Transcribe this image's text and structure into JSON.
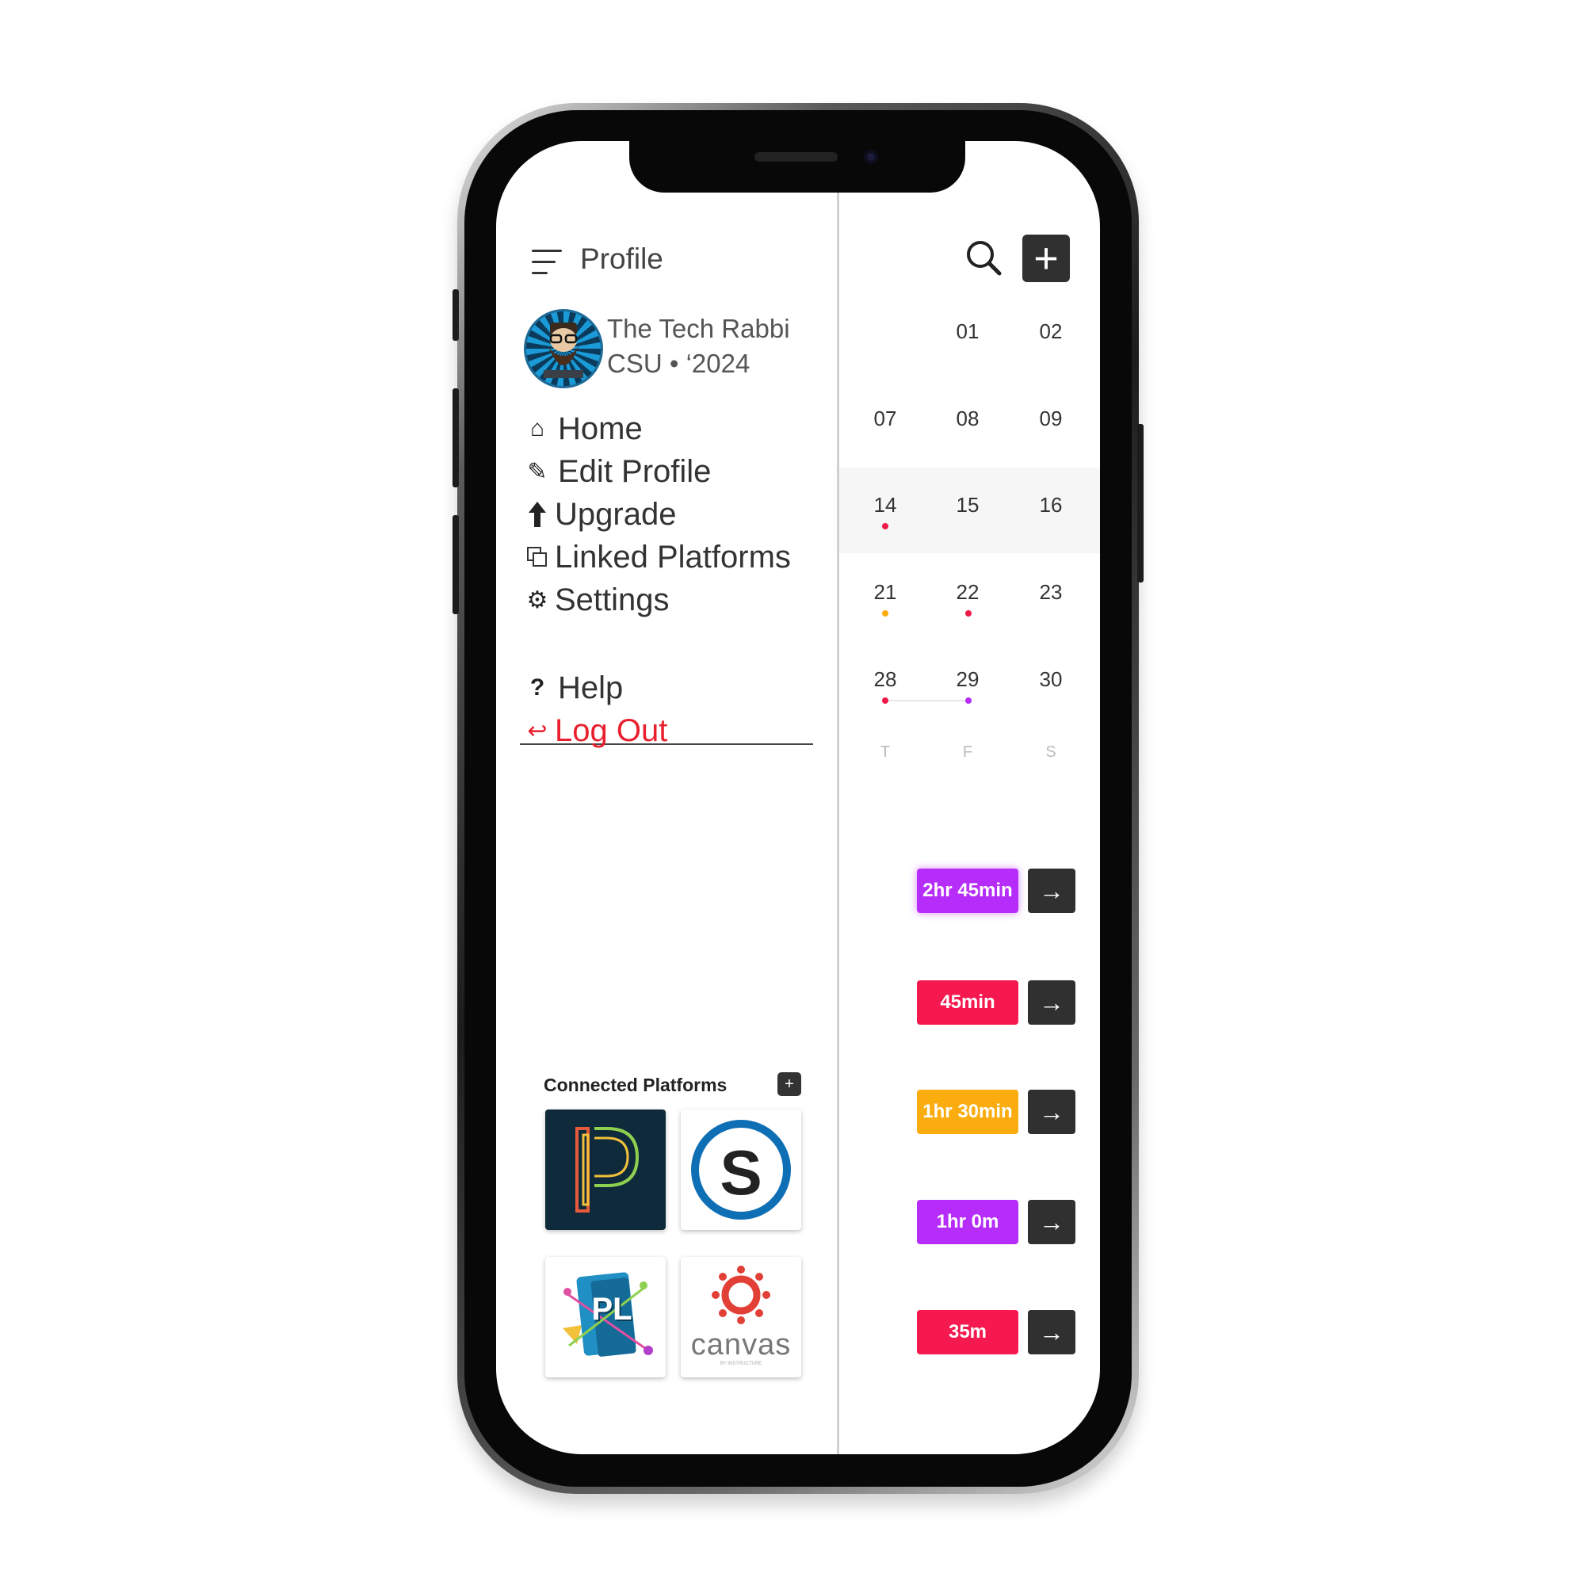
{
  "drawer": {
    "title": "Profile",
    "user_name": "The Tech Rabbi",
    "user_sub": "CSU • ‘2024",
    "nav": [
      {
        "label": "Home",
        "icon": "home-icon"
      },
      {
        "label": "Edit Profile",
        "icon": "pencil-icon"
      },
      {
        "label": "Upgrade",
        "icon": "up-arrow-icon"
      },
      {
        "label": "Linked Platforms",
        "icon": "linked-windows-icon"
      },
      {
        "label": "Settings",
        "icon": "gear-icon"
      }
    ],
    "help": {
      "label": "Help",
      "icon": "question-icon"
    },
    "logout": {
      "label": "Log Out",
      "icon": "return-arrow-icon"
    },
    "connected_platforms": {
      "label": "Connected Platforms",
      "add_label": "+",
      "tiles": [
        {
          "name": "PowerSchool",
          "icon": "powerschool-logo"
        },
        {
          "name": "Schoology",
          "icon": "schoology-logo",
          "letter": "S"
        },
        {
          "name": "PL",
          "icon": "pl-logo",
          "letter": "PL"
        },
        {
          "name": "canvas",
          "icon": "canvas-logo",
          "wordmark": "canvas",
          "tagline": "BY INSTRUCTURE"
        }
      ]
    }
  },
  "calendar": {
    "add_label": "+",
    "rows": [
      [
        "",
        "01",
        "02"
      ],
      [
        "07",
        "08",
        "09"
      ],
      [
        "14",
        "15",
        "16"
      ],
      [
        "21",
        "22",
        "23"
      ],
      [
        "28",
        "29",
        "30"
      ]
    ],
    "weekdays": [
      "T",
      "F",
      "S"
    ]
  },
  "durations": [
    {
      "label": "2hr 45min",
      "color": "#b62dfa"
    },
    {
      "label": "45min",
      "color": "#f5194f"
    },
    {
      "label": "1hr 30min",
      "color": "#fbac0f"
    },
    {
      "label": "1hr 0m",
      "color": "#b62dfa"
    },
    {
      "label": "35m",
      "color": "#f5194f"
    }
  ],
  "colors": {
    "accent_dark": "#303030",
    "logout_red": "#e8202e",
    "dot_red": "#ee1846",
    "dot_orange": "#fbac0f",
    "dot_purple": "#b62dfa"
  }
}
